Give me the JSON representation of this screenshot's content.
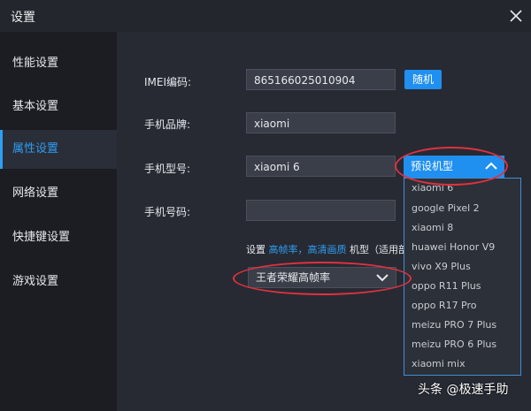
{
  "window": {
    "title": "设置"
  },
  "sidebar": {
    "items": [
      {
        "label": "性能设置"
      },
      {
        "label": "基本设置"
      },
      {
        "label": "属性设置",
        "active": true
      },
      {
        "label": "网络设置"
      },
      {
        "label": "快捷键设置"
      },
      {
        "label": "游戏设置"
      }
    ]
  },
  "form": {
    "imei_label": "IMEI编码:",
    "imei_value": "865166025010904",
    "random_button": "随机",
    "brand_label": "手机品牌:",
    "brand_value": "xiaomi",
    "model_label": "手机型号:",
    "model_value": "xiaomi 6",
    "preset_select": "预设机型",
    "phone_label": "手机号码:",
    "phone_value": "",
    "hint_prefix": "设置",
    "hint_link1": "高帧率",
    "hint_sep": "，",
    "hint_link2": "高清画质",
    "hint_suffix": "机型（适用部",
    "game_select": "王者荣耀高帧率"
  },
  "preset_options": [
    "xiaomi 6",
    "google Pixel 2",
    "xiaomi 8",
    "huawei Honor V9",
    "vivo X9 Plus",
    "oppo R11 Plus",
    "oppo R17 Pro",
    "meizu PRO 7 Plus",
    "meizu PRO 6 Plus",
    "xiaomi mix"
  ],
  "watermark": "头条 @极速手助",
  "colors": {
    "accent": "#1f8ff0",
    "highlight_ring": "#e0313f"
  }
}
